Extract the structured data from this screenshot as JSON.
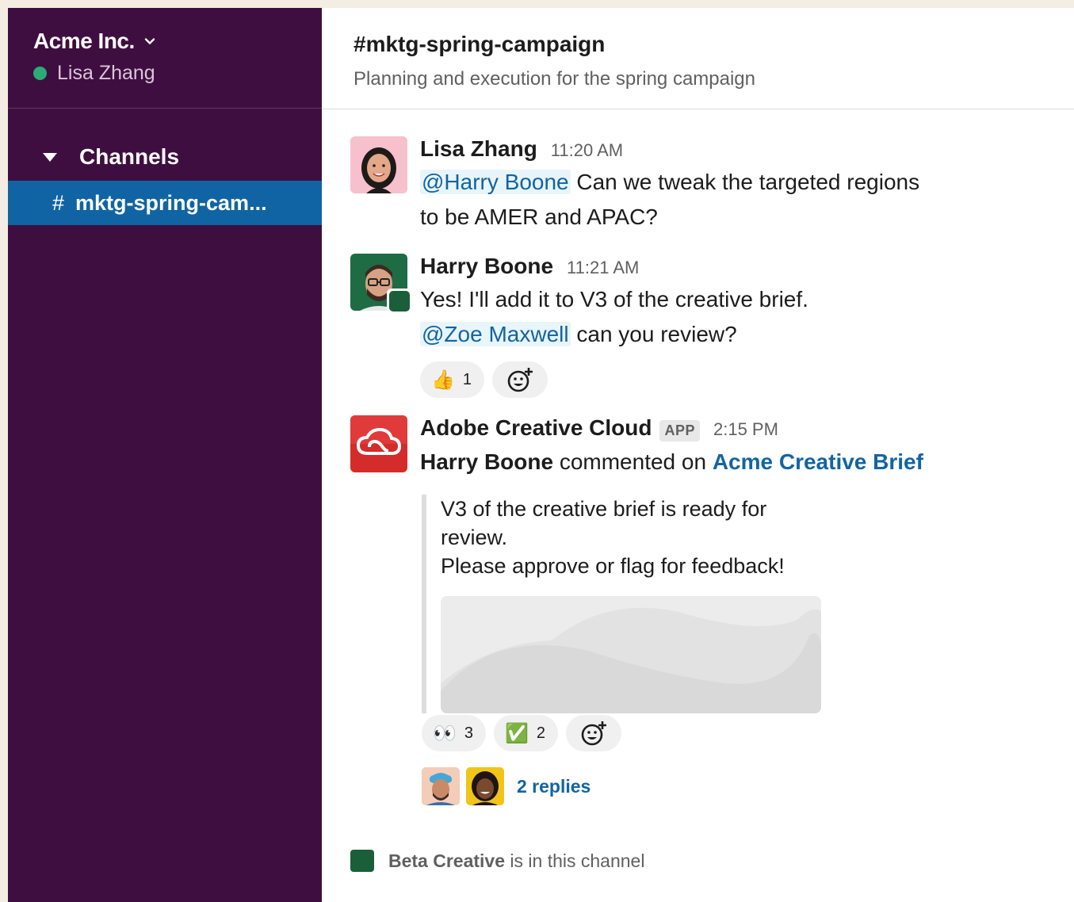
{
  "workspace": {
    "name": "Acme Inc.",
    "user": "Lisa Zhang"
  },
  "sidebar": {
    "section_label": "Channels",
    "channels": [
      {
        "hash": "#",
        "label": "mktg-spring-cam..."
      }
    ]
  },
  "channel": {
    "title": "#mktg-spring-campaign",
    "topic": "Planning and execution for the spring campaign"
  },
  "messages": [
    {
      "author": "Lisa Zhang",
      "time": "11:20 AM",
      "mention": "@Harry Boone",
      "text_after_mention": " Can we tweak the targeted regions",
      "text_line2": "to be AMER and APAC?"
    },
    {
      "author": "Harry Boone",
      "time": "11:21 AM",
      "text_line1": "Yes! I'll add it to V3 of the creative brief.",
      "mention": "@Zoe Maxwell",
      "text_after_mention": " can you review?",
      "reactions": [
        {
          "emoji": "👍",
          "count": "1"
        }
      ]
    },
    {
      "author": "Adobe Creative Cloud",
      "badge": "APP",
      "time": "2:15 PM",
      "actor": "Harry Boone",
      "action": " commented on ",
      "doc_link": "Acme Creative Brief",
      "quote_line1": "V3 of the creative brief is ready for review.",
      "quote_line2": "Please approve or flag for feedback!",
      "reactions": [
        {
          "emoji": "👀",
          "count": "3"
        },
        {
          "emoji": "✅",
          "count": "2"
        }
      ],
      "replies": "2 replies"
    }
  ],
  "footer": {
    "name": "Beta Creative",
    "text": " is in this channel"
  },
  "colors": {
    "sidebar_bg": "#3f0e40",
    "active_channel": "#1164a3",
    "link": "#1264a3",
    "presence": "#2bac76"
  }
}
